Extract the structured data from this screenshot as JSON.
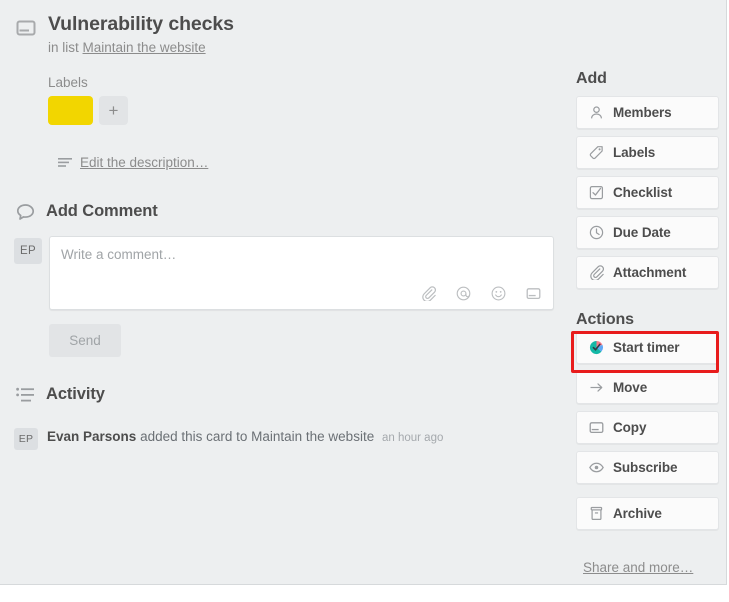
{
  "card": {
    "icon": "card-icon",
    "title": "Vulnerability checks",
    "in_list_prefix": "in list",
    "list_name": "Maintain the website"
  },
  "labels": {
    "heading": "Labels",
    "chips": [
      {
        "name": "yellow-label",
        "color": "#f2d600"
      }
    ],
    "add_label": "+"
  },
  "description": {
    "icon": "description-lines-icon",
    "link_text": "Edit the description…"
  },
  "add_comment": {
    "icon": "comment-bubble-icon",
    "heading": "Add Comment",
    "avatar_initials": "EP",
    "placeholder": "Write a comment…",
    "tools": [
      {
        "name": "attachment-icon",
        "title": "Attach"
      },
      {
        "name": "mention-icon",
        "title": "Mention"
      },
      {
        "name": "emoji-icon",
        "title": "Emoji"
      },
      {
        "name": "card-icon",
        "title": "Card"
      }
    ],
    "send_label": "Send"
  },
  "activity": {
    "icon": "activity-list-icon",
    "heading": "Activity",
    "entries": [
      {
        "avatar_initials": "EP",
        "author": "Evan Parsons",
        "text": "added this card to Maintain the website",
        "time": "an hour ago"
      }
    ]
  },
  "sidebar": {
    "add_heading": "Add",
    "add_items": [
      {
        "name": "sidebar-item-members",
        "icon": "person-icon",
        "label": "Members"
      },
      {
        "name": "sidebar-item-labels",
        "icon": "label-tag-icon",
        "label": "Labels"
      },
      {
        "name": "sidebar-item-checklist",
        "icon": "checkbox-icon",
        "label": "Checklist"
      },
      {
        "name": "sidebar-item-due-date",
        "icon": "clock-icon",
        "label": "Due Date"
      },
      {
        "name": "sidebar-item-attachment",
        "icon": "paperclip-icon",
        "label": "Attachment"
      }
    ],
    "actions_heading": "Actions",
    "action_items": [
      {
        "name": "sidebar-item-start-timer",
        "icon": "everhour-timer-icon",
        "label": "Start timer",
        "highlighted": true
      },
      {
        "name": "sidebar-item-move",
        "icon": "arrow-right-icon",
        "label": "Move"
      },
      {
        "name": "sidebar-item-copy",
        "icon": "card-icon",
        "label": "Copy"
      },
      {
        "name": "sidebar-item-subscribe",
        "icon": "eye-icon",
        "label": "Subscribe"
      },
      {
        "name": "sidebar-item-archive",
        "icon": "archive-box-icon",
        "label": "Archive"
      }
    ],
    "share_link": "Share and more…"
  },
  "annotation": {
    "target": "Start timer",
    "color": "#e81c1c"
  },
  "colors": {
    "background": "#edeff0",
    "button_face": "#fbfbfb",
    "text_primary": "#4d4d4d",
    "text_muted": "#8c8c8c",
    "label_yellow": "#f2d600",
    "highlight_red": "#e81c1c"
  }
}
